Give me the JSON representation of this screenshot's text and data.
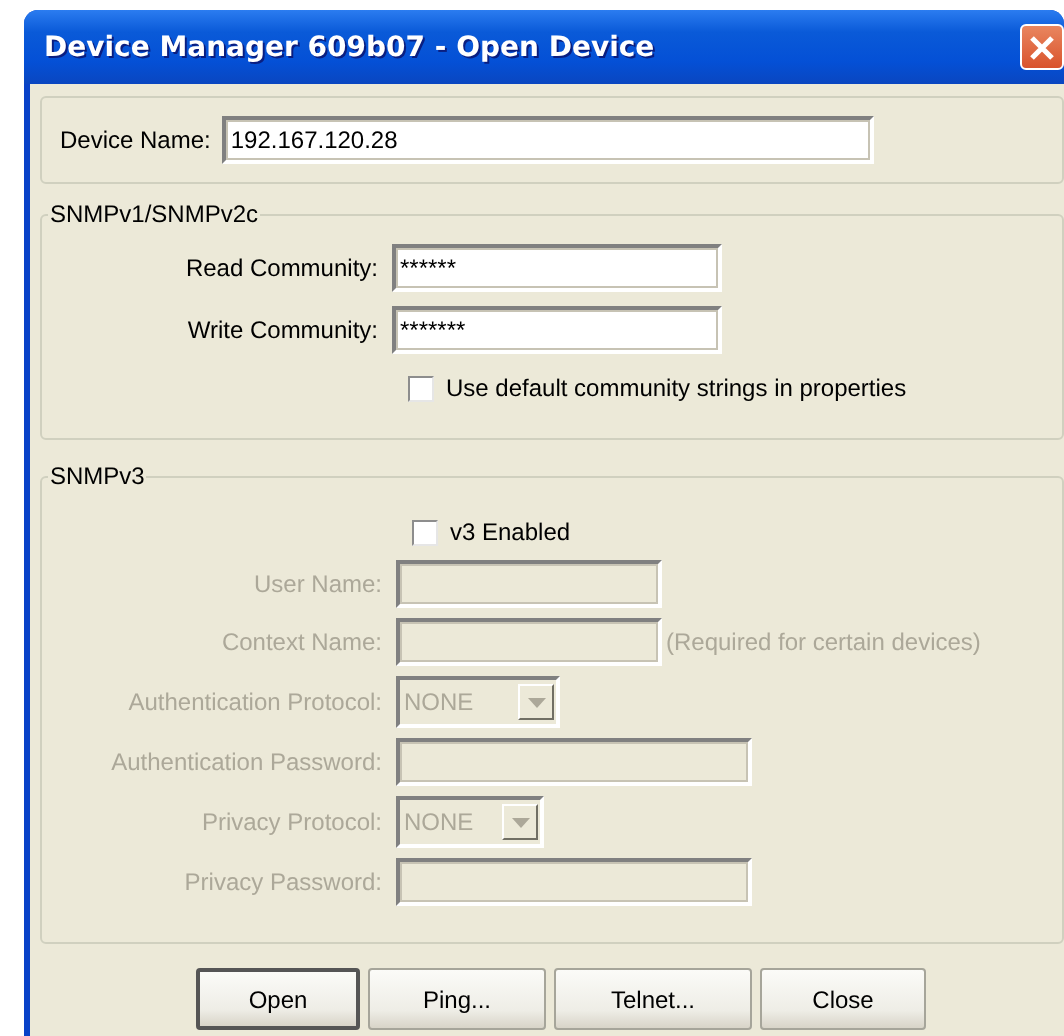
{
  "window": {
    "title": "Device Manager 609b07 - Open Device"
  },
  "device_name": {
    "label": "Device Name:",
    "value": "192.167.120.28"
  },
  "snmp_v1": {
    "title": "SNMPv1/SNMPv2c",
    "fields": [
      {
        "kind": "text",
        "label": "Read Community:",
        "value": "******",
        "disabled": false
      },
      {
        "kind": "text",
        "label": "Write Community:",
        "value": "*******",
        "disabled": false
      }
    ],
    "checkbox": {
      "label": "Use default community strings in properties",
      "checked": false
    }
  },
  "snmp_v3": {
    "title": "SNMPv3",
    "checkbox": {
      "label": "v3 Enabled",
      "checked": false
    },
    "fields": [
      {
        "kind": "text",
        "label": "User Name:",
        "disabled": true
      },
      {
        "kind": "text",
        "label": "Context Name:",
        "disabled": true,
        "note": "(Required for certain devices)"
      },
      {
        "kind": "select",
        "label": "Authentication Protocol:",
        "value": "NONE",
        "disabled": true
      },
      {
        "kind": "text",
        "label": "Authentication Password:",
        "disabled": true
      },
      {
        "kind": "select",
        "label": "Privacy Protocol:",
        "value": "NONE",
        "disabled": true
      },
      {
        "kind": "text",
        "label": "Privacy Password:",
        "disabled": true
      }
    ]
  },
  "buttons": [
    {
      "label": "Open",
      "default": true
    },
    {
      "label": "Ping...",
      "default": false
    },
    {
      "label": "Telnet...",
      "default": false
    },
    {
      "label": "Close",
      "default": false
    }
  ]
}
